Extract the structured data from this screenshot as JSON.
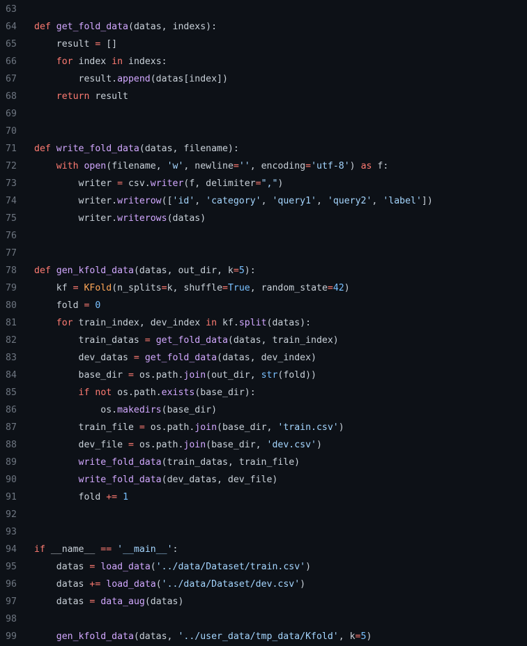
{
  "editor": {
    "theme_colors": {
      "background": "#0d1117",
      "line_number": "#6e7681",
      "text": "#c9d1d9",
      "keyword": "#ff7b72",
      "function": "#d2a8ff",
      "string": "#a5d6ff",
      "number": "#79c0ff",
      "class": "#ffa657"
    },
    "lines": [
      {
        "n": "63",
        "tokens": []
      },
      {
        "n": "64",
        "tokens": [
          [
            "kw",
            "def"
          ],
          [
            "pl",
            " "
          ],
          [
            "fn",
            "get_fold_data"
          ],
          [
            "pl",
            "(datas, indexs):"
          ]
        ]
      },
      {
        "n": "65",
        "tokens": [
          [
            "pl",
            "    result "
          ],
          [
            "op",
            "="
          ],
          [
            "pl",
            " []"
          ]
        ]
      },
      {
        "n": "66",
        "tokens": [
          [
            "pl",
            "    "
          ],
          [
            "kw",
            "for"
          ],
          [
            "pl",
            " index "
          ],
          [
            "kw",
            "in"
          ],
          [
            "pl",
            " indexs:"
          ]
        ]
      },
      {
        "n": "67",
        "tokens": [
          [
            "pl",
            "        result."
          ],
          [
            "fn",
            "append"
          ],
          [
            "pl",
            "(datas[index])"
          ]
        ]
      },
      {
        "n": "68",
        "tokens": [
          [
            "pl",
            "    "
          ],
          [
            "kw",
            "return"
          ],
          [
            "pl",
            " result"
          ]
        ]
      },
      {
        "n": "69",
        "tokens": []
      },
      {
        "n": "70",
        "tokens": []
      },
      {
        "n": "71",
        "tokens": [
          [
            "kw",
            "def"
          ],
          [
            "pl",
            " "
          ],
          [
            "fn",
            "write_fold_data"
          ],
          [
            "pl",
            "(datas, filename):"
          ]
        ]
      },
      {
        "n": "72",
        "tokens": [
          [
            "pl",
            "    "
          ],
          [
            "kw",
            "with"
          ],
          [
            "pl",
            " "
          ],
          [
            "fn",
            "open"
          ],
          [
            "pl",
            "(filename, "
          ],
          [
            "str",
            "'w'"
          ],
          [
            "pl",
            ", newline"
          ],
          [
            "op",
            "="
          ],
          [
            "str",
            "''"
          ],
          [
            "pl",
            ", encoding"
          ],
          [
            "op",
            "="
          ],
          [
            "str",
            "'utf-8'"
          ],
          [
            "pl",
            ") "
          ],
          [
            "kw",
            "as"
          ],
          [
            "pl",
            " f:"
          ]
        ]
      },
      {
        "n": "73",
        "tokens": [
          [
            "pl",
            "        writer "
          ],
          [
            "op",
            "="
          ],
          [
            "pl",
            " csv."
          ],
          [
            "fn",
            "writer"
          ],
          [
            "pl",
            "(f, delimiter"
          ],
          [
            "op",
            "="
          ],
          [
            "str",
            "\",\""
          ],
          [
            "pl",
            ")"
          ]
        ]
      },
      {
        "n": "74",
        "tokens": [
          [
            "pl",
            "        writer."
          ],
          [
            "fn",
            "writerow"
          ],
          [
            "pl",
            "(["
          ],
          [
            "str",
            "'id'"
          ],
          [
            "pl",
            ", "
          ],
          [
            "str",
            "'category'"
          ],
          [
            "pl",
            ", "
          ],
          [
            "str",
            "'query1'"
          ],
          [
            "pl",
            ", "
          ],
          [
            "str",
            "'query2'"
          ],
          [
            "pl",
            ", "
          ],
          [
            "str",
            "'label'"
          ],
          [
            "pl",
            "])"
          ]
        ]
      },
      {
        "n": "75",
        "tokens": [
          [
            "pl",
            "        writer."
          ],
          [
            "fn",
            "writerows"
          ],
          [
            "pl",
            "(datas)"
          ]
        ]
      },
      {
        "n": "76",
        "tokens": []
      },
      {
        "n": "77",
        "tokens": []
      },
      {
        "n": "78",
        "tokens": [
          [
            "kw",
            "def"
          ],
          [
            "pl",
            " "
          ],
          [
            "fn",
            "gen_kfold_data"
          ],
          [
            "pl",
            "(datas, out_dir, k"
          ],
          [
            "op",
            "="
          ],
          [
            "num",
            "5"
          ],
          [
            "pl",
            "):"
          ]
        ]
      },
      {
        "n": "79",
        "tokens": [
          [
            "pl",
            "    kf "
          ],
          [
            "op",
            "="
          ],
          [
            "pl",
            " "
          ],
          [
            "cls",
            "KFold"
          ],
          [
            "pl",
            "(n_splits"
          ],
          [
            "op",
            "="
          ],
          [
            "pl",
            "k, shuffle"
          ],
          [
            "op",
            "="
          ],
          [
            "num",
            "True"
          ],
          [
            "pl",
            ", random_state"
          ],
          [
            "op",
            "="
          ],
          [
            "num",
            "42"
          ],
          [
            "pl",
            ")"
          ]
        ]
      },
      {
        "n": "80",
        "tokens": [
          [
            "pl",
            "    fold "
          ],
          [
            "op",
            "="
          ],
          [
            "pl",
            " "
          ],
          [
            "num",
            "0"
          ]
        ]
      },
      {
        "n": "81",
        "tokens": [
          [
            "pl",
            "    "
          ],
          [
            "kw",
            "for"
          ],
          [
            "pl",
            " train_index, dev_index "
          ],
          [
            "kw",
            "in"
          ],
          [
            "pl",
            " kf."
          ],
          [
            "fn",
            "split"
          ],
          [
            "pl",
            "(datas):"
          ]
        ]
      },
      {
        "n": "82",
        "tokens": [
          [
            "pl",
            "        train_datas "
          ],
          [
            "op",
            "="
          ],
          [
            "pl",
            " "
          ],
          [
            "fn",
            "get_fold_data"
          ],
          [
            "pl",
            "(datas, train_index)"
          ]
        ]
      },
      {
        "n": "83",
        "tokens": [
          [
            "pl",
            "        dev_datas "
          ],
          [
            "op",
            "="
          ],
          [
            "pl",
            " "
          ],
          [
            "fn",
            "get_fold_data"
          ],
          [
            "pl",
            "(datas, dev_index)"
          ]
        ]
      },
      {
        "n": "84",
        "tokens": [
          [
            "pl",
            "        base_dir "
          ],
          [
            "op",
            "="
          ],
          [
            "pl",
            " os.path."
          ],
          [
            "fn",
            "join"
          ],
          [
            "pl",
            "(out_dir, "
          ],
          [
            "bi",
            "str"
          ],
          [
            "pl",
            "(fold))"
          ]
        ]
      },
      {
        "n": "85",
        "tokens": [
          [
            "pl",
            "        "
          ],
          [
            "kw",
            "if"
          ],
          [
            "pl",
            " "
          ],
          [
            "kw",
            "not"
          ],
          [
            "pl",
            " os.path."
          ],
          [
            "fn",
            "exists"
          ],
          [
            "pl",
            "(base_dir):"
          ]
        ]
      },
      {
        "n": "86",
        "tokens": [
          [
            "pl",
            "            os."
          ],
          [
            "fn",
            "makedirs"
          ],
          [
            "pl",
            "(base_dir)"
          ]
        ]
      },
      {
        "n": "87",
        "tokens": [
          [
            "pl",
            "        train_file "
          ],
          [
            "op",
            "="
          ],
          [
            "pl",
            " os.path."
          ],
          [
            "fn",
            "join"
          ],
          [
            "pl",
            "(base_dir, "
          ],
          [
            "str",
            "'train.csv'"
          ],
          [
            "pl",
            ")"
          ]
        ]
      },
      {
        "n": "88",
        "tokens": [
          [
            "pl",
            "        dev_file "
          ],
          [
            "op",
            "="
          ],
          [
            "pl",
            " os.path."
          ],
          [
            "fn",
            "join"
          ],
          [
            "pl",
            "(base_dir, "
          ],
          [
            "str",
            "'dev.csv'"
          ],
          [
            "pl",
            ")"
          ]
        ]
      },
      {
        "n": "89",
        "tokens": [
          [
            "pl",
            "        "
          ],
          [
            "fn",
            "write_fold_data"
          ],
          [
            "pl",
            "(train_datas, train_file)"
          ]
        ]
      },
      {
        "n": "90",
        "tokens": [
          [
            "pl",
            "        "
          ],
          [
            "fn",
            "write_fold_data"
          ],
          [
            "pl",
            "(dev_datas, dev_file)"
          ]
        ]
      },
      {
        "n": "91",
        "tokens": [
          [
            "pl",
            "        fold "
          ],
          [
            "op",
            "+="
          ],
          [
            "pl",
            " "
          ],
          [
            "num",
            "1"
          ]
        ]
      },
      {
        "n": "92",
        "tokens": []
      },
      {
        "n": "93",
        "tokens": []
      },
      {
        "n": "94",
        "tokens": [
          [
            "kw",
            "if"
          ],
          [
            "pl",
            " __name__ "
          ],
          [
            "op",
            "=="
          ],
          [
            "pl",
            " "
          ],
          [
            "str",
            "'__main__'"
          ],
          [
            "pl",
            ":"
          ]
        ]
      },
      {
        "n": "95",
        "tokens": [
          [
            "pl",
            "    datas "
          ],
          [
            "op",
            "="
          ],
          [
            "pl",
            " "
          ],
          [
            "fn",
            "load_data"
          ],
          [
            "pl",
            "("
          ],
          [
            "str",
            "'../data/Dataset/train.csv'"
          ],
          [
            "pl",
            ")"
          ]
        ]
      },
      {
        "n": "96",
        "tokens": [
          [
            "pl",
            "    datas "
          ],
          [
            "op",
            "+="
          ],
          [
            "pl",
            " "
          ],
          [
            "fn",
            "load_data"
          ],
          [
            "pl",
            "("
          ],
          [
            "str",
            "'../data/Dataset/dev.csv'"
          ],
          [
            "pl",
            ")"
          ]
        ]
      },
      {
        "n": "97",
        "tokens": [
          [
            "pl",
            "    datas "
          ],
          [
            "op",
            "="
          ],
          [
            "pl",
            " "
          ],
          [
            "fn",
            "data_aug"
          ],
          [
            "pl",
            "(datas)"
          ]
        ]
      },
      {
        "n": "98",
        "tokens": []
      },
      {
        "n": "99",
        "tokens": [
          [
            "pl",
            "    "
          ],
          [
            "fn",
            "gen_kfold_data"
          ],
          [
            "pl",
            "(datas, "
          ],
          [
            "str",
            "'../user_data/tmp_data/Kfold'"
          ],
          [
            "pl",
            ", k"
          ],
          [
            "op",
            "="
          ],
          [
            "num",
            "5"
          ],
          [
            "pl",
            ")"
          ]
        ]
      }
    ]
  }
}
